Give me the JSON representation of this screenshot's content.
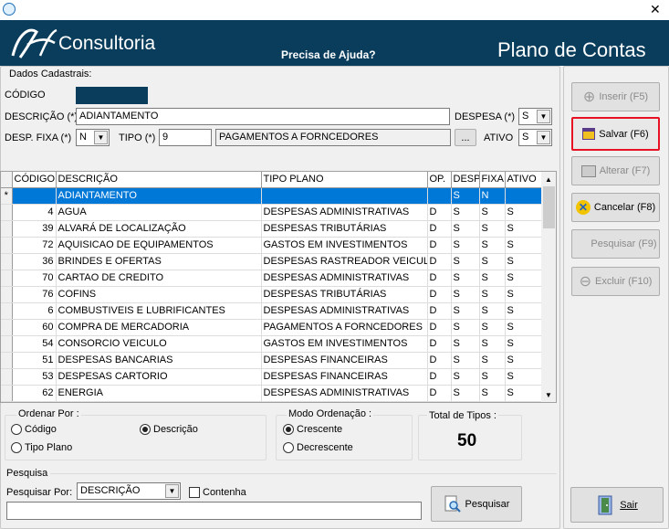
{
  "window": {
    "close": "✕"
  },
  "header": {
    "brand": "Consultoria",
    "help": "Precisa de Ajuda?",
    "title": "Plano de Contas"
  },
  "form": {
    "section": "Dados Cadastrais:",
    "codigo_label": "CÓDIGO",
    "codigo_value": "",
    "descricao_label": "DESCRIÇÃO (*)",
    "descricao_value": "ADIANTAMENTO",
    "despesa_label": "DESPESA (*)",
    "despesa_value": "S",
    "desp_fixa_label": "DESP. FIXA (*)",
    "desp_fixa_value": "N",
    "tipo_label": "TIPO (*)",
    "tipo_value": "9",
    "tipo_desc": "PAGAMENTOS A FORNCEDORES",
    "ellipsis": "...",
    "ativo_label": "ATIVO",
    "ativo_value": "S"
  },
  "grid": {
    "columns": [
      "CÓDIGO",
      "DESCRIÇÃO",
      "TIPO PLANO",
      "OP.",
      "DESP",
      "FIXA",
      "ATIVO"
    ],
    "rows": [
      {
        "ind": "*",
        "codigo": "",
        "descricao": "ADIANTAMENTO",
        "tipo": "",
        "op": "",
        "desp": "S",
        "fixa": "N",
        "ativo": ""
      },
      {
        "ind": "",
        "codigo": "4",
        "descricao": "AGUA",
        "tipo": "DESPESAS ADMINISTRATIVAS",
        "op": "D",
        "desp": "S",
        "fixa": "S",
        "ativo": "S"
      },
      {
        "ind": "",
        "codigo": "39",
        "descricao": "ALVARÁ DE LOCALIZAÇÃO",
        "tipo": "DESPESAS TRIBUTÁRIAS",
        "op": "D",
        "desp": "S",
        "fixa": "S",
        "ativo": "S"
      },
      {
        "ind": "",
        "codigo": "72",
        "descricao": "AQUISICAO DE EQUIPAMENTOS",
        "tipo": "GASTOS EM INVESTIMENTOS",
        "op": "D",
        "desp": "S",
        "fixa": "S",
        "ativo": "S"
      },
      {
        "ind": "",
        "codigo": "36",
        "descricao": "BRINDES E OFERTAS",
        "tipo": "DESPESAS RASTREADOR VEICUL",
        "op": "D",
        "desp": "S",
        "fixa": "S",
        "ativo": "S"
      },
      {
        "ind": "",
        "codigo": "70",
        "descricao": "CARTAO DE CREDITO",
        "tipo": "DESPESAS ADMINISTRATIVAS",
        "op": "D",
        "desp": "S",
        "fixa": "S",
        "ativo": "S"
      },
      {
        "ind": "",
        "codigo": "76",
        "descricao": "COFINS",
        "tipo": "DESPESAS TRIBUTÁRIAS",
        "op": "D",
        "desp": "S",
        "fixa": "S",
        "ativo": "S"
      },
      {
        "ind": "",
        "codigo": "6",
        "descricao": "COMBUSTIVEIS E LUBRIFICANTES",
        "tipo": "DESPESAS ADMINISTRATIVAS",
        "op": "D",
        "desp": "S",
        "fixa": "S",
        "ativo": "S"
      },
      {
        "ind": "",
        "codigo": "60",
        "descricao": "COMPRA DE MERCADORIA",
        "tipo": "PAGAMENTOS A FORNCEDORES",
        "op": "D",
        "desp": "S",
        "fixa": "S",
        "ativo": "S"
      },
      {
        "ind": "",
        "codigo": "54",
        "descricao": "CONSORCIO VEICULO",
        "tipo": "GASTOS EM INVESTIMENTOS",
        "op": "D",
        "desp": "S",
        "fixa": "S",
        "ativo": "S"
      },
      {
        "ind": "",
        "codigo": "51",
        "descricao": "DESPESAS  BANCARIAS",
        "tipo": "DESPESAS FINANCEIRAS",
        "op": "D",
        "desp": "S",
        "fixa": "S",
        "ativo": "S"
      },
      {
        "ind": "",
        "codigo": "53",
        "descricao": "DESPESAS CARTORIO",
        "tipo": "DESPESAS FINANCEIRAS",
        "op": "D",
        "desp": "S",
        "fixa": "S",
        "ativo": "S"
      },
      {
        "ind": "",
        "codigo": "62",
        "descricao": "ENERGIA",
        "tipo": "DESPESAS ADMINISTRATIVAS",
        "op": "D",
        "desp": "S",
        "fixa": "S",
        "ativo": "S"
      }
    ]
  },
  "ordenar": {
    "title": "Ordenar Por :",
    "codigo": "Código",
    "descricao": "Descrição",
    "tipo": "Tipo Plano"
  },
  "modo": {
    "title": "Modo Ordenação :",
    "crescente": "Crescente",
    "decrescente": "Decrescente"
  },
  "total": {
    "title": "Total de Tipos :",
    "value": "50"
  },
  "pesquisa": {
    "section": "Pesquisa",
    "label": "Pesquisar Por:",
    "field": "DESCRIÇÃO",
    "contenha": "Contenha",
    "button": "Pesquisar",
    "input_value": ""
  },
  "buttons": {
    "inserir": "Inserir (F5)",
    "salvar": "Salvar (F6)",
    "alterar": "Alterar (F7)",
    "cancelar": "Cancelar (F8)",
    "pesquisar": "Pesquisar (F9)",
    "excluir": "Excluir (F10)",
    "sair": "Sair"
  },
  "colors": {
    "header": "#0a3d5c",
    "selection": "#0078d7",
    "highlight": "#e81123"
  }
}
